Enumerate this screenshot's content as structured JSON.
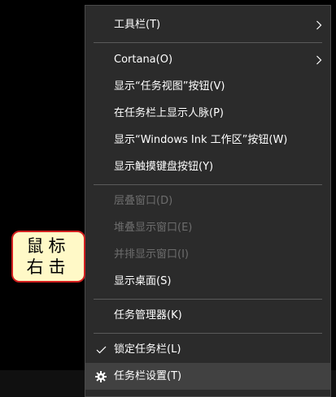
{
  "menu": {
    "toolbars": "工具栏(T)",
    "cortana": "Cortana(O)",
    "show_task_view": "显示“任务视图”按钮(V)",
    "show_people": "在任务栏上显示人脉(P)",
    "show_ink": "显示“Windows Ink 工作区”按钮(W)",
    "show_touch_keyboard": "显示触摸键盘按钮(Y)",
    "cascade": "层叠窗口(D)",
    "stacked": "堆叠显示窗口(E)",
    "side_by_side": "并排显示窗口(I)",
    "show_desktop": "显示桌面(S)",
    "task_manager": "任务管理器(K)",
    "lock_taskbar": "锁定任务栏(L)",
    "taskbar_settings": "任务栏设置(T)"
  },
  "callout": {
    "line1": "鼠标",
    "line2": "右击"
  },
  "icons": {
    "submenu": "chevron-right-icon",
    "checked": "checkmark-icon",
    "settings": "gear-icon"
  },
  "colors": {
    "menu_background": "#2b2b2b",
    "menu_text": "#ffffff",
    "disabled_text": "#6d6d6d",
    "hover_background": "#414141",
    "callout_background": "#fff9c7",
    "callout_border": "#d21f1f"
  }
}
